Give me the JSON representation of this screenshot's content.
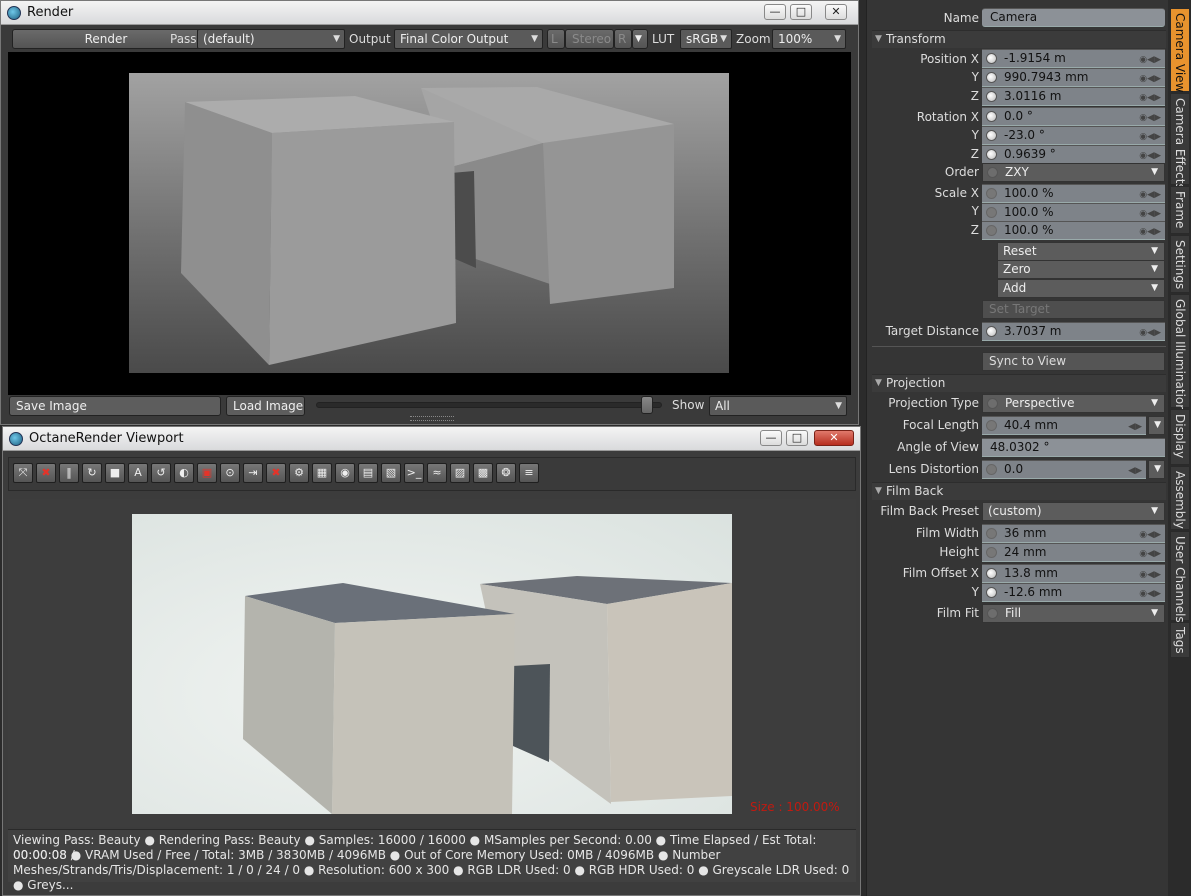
{
  "render_window": {
    "title": "Render",
    "render_button": "Render",
    "pass_label": "Pass",
    "pass_value": "(default)",
    "output_label": "Output",
    "output_value": "Final Color Output",
    "l_label": "L",
    "stereo_label": "Stereo",
    "r_label": "R",
    "lut_label": "LUT",
    "lut_value": "sRGB",
    "zoom_label": "Zoom",
    "zoom_value": "100%",
    "save_image": "Save Image",
    "load_image": "Load Image",
    "show_label": "Show",
    "show_value": "All"
  },
  "viewport_window": {
    "title": "OctaneRender Viewport",
    "size_overlay": "Size : 100.00%",
    "tools": [
      "fit-icon",
      "stop-render-icon",
      "pause-icon",
      "restart-icon",
      "stop-icon",
      "api-icon",
      "refresh-icon",
      "color-wheel-icon",
      "picker-icon",
      "camera-pick-icon",
      "export-icon",
      "clear-icon",
      "settings-icon",
      "region-icon",
      "snapshot-icon",
      "layers-icon",
      "cube-icon",
      "terminal-icon",
      "graph-icon",
      "image-icon",
      "checker-icon",
      "gizmo-icon",
      "notes-icon"
    ],
    "status_lines": [
      "Viewing Pass: Beauty ●  Rendering Pass: Beauty ●  Samples: 16000  / 16000 ●  MSamples per Second: 0.00 ●  Time Elapsed / Est Total: 00:00:08 /",
      "00:00:08 ●  VRAM Used / Free / Total: 3MB / 3830MB / 4096MB ●  Out of Core Memory Used: 0MB / 4096MB ●  Number",
      "Meshes/Strands/Tris/Displacement: 1 / 0 / 24 / 0 ●  Resolution: 600 x 300 ●  RGB LDR Used: 0 ●  RGB HDR Used: 0 ●  Greyscale LDR Used: 0 ●  Greys..."
    ]
  },
  "panel": {
    "name_label": "Name",
    "name_value": "Camera",
    "transform": "Transform",
    "position_x_label": "Position X",
    "position_x": "-1.9154 m",
    "position_y": "990.7943 mm",
    "position_z": "3.0116 m",
    "rotation_x_label": "Rotation X",
    "rotation_x": "0.0 °",
    "rotation_y": "-23.0 °",
    "rotation_z": "0.9639 °",
    "order_label": "Order",
    "order_value": "ZXY",
    "scale_x_label": "Scale X",
    "scale_x": "100.0 %",
    "scale_y": "100.0 %",
    "scale_z": "100.0 %",
    "y_label": "Y",
    "z_label": "Z",
    "reset": "Reset",
    "zero": "Zero",
    "add": "Add",
    "set_target": "Set Target",
    "target_distance_label": "Target Distance",
    "target_distance": "3.7037 m",
    "sync_to_view": "Sync to View",
    "projection": "Projection",
    "projection_type_label": "Projection Type",
    "projection_type": "Perspective",
    "focal_length_label": "Focal Length",
    "focal_length": "40.4 mm",
    "angle_of_view_label": "Angle of View",
    "angle_of_view": "48.0302 °",
    "lens_distortion_label": "Lens Distortion",
    "lens_distortion": "0.0",
    "film_back": "Film Back",
    "film_back_preset_label": "Film Back Preset",
    "film_back_preset": "(custom)",
    "film_width_label": "Film Width",
    "film_width": "36 mm",
    "height_label": "Height",
    "film_height": "24 mm",
    "film_offset_x_label": "Film Offset X",
    "film_offset_x": "13.8 mm",
    "film_offset_y": "-12.6 mm",
    "film_fit_label": "Film Fit",
    "film_fit": "Fill"
  },
  "vertical_tabs": [
    "Camera View",
    "Camera Effects",
    "Frame",
    "Settings",
    "Global Illumination",
    "Display",
    "Assembly",
    "User Channels",
    "Tags"
  ]
}
